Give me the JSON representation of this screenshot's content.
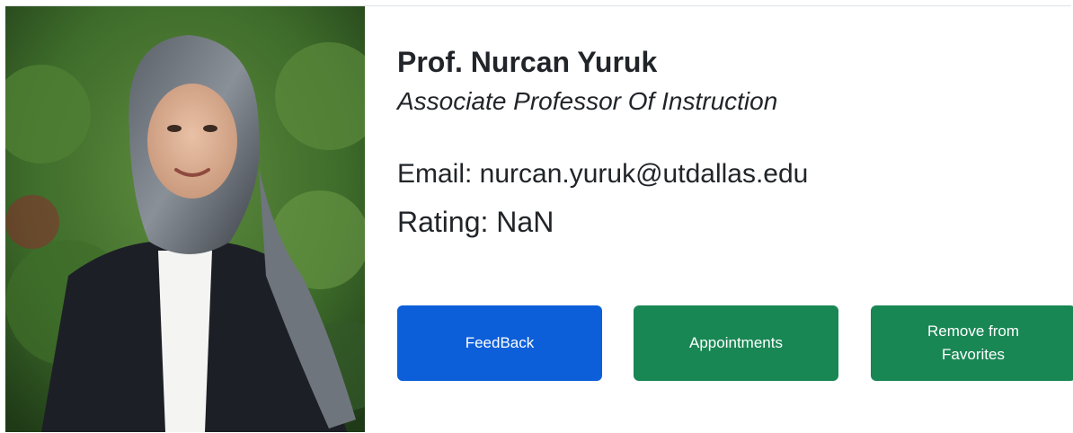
{
  "profile": {
    "name": "Prof. Nurcan Yuruk",
    "title": "Associate Professor Of Instruction",
    "email_label": "Email: nurcan.yuruk@utdallas.edu",
    "rating_label": "Rating: NaN",
    "photo_alt": "Prof. Nurcan Yuruk"
  },
  "actions": {
    "feedback_label": "FeedBack",
    "appointments_label": "Appointments",
    "remove_favorites_label": "Remove from Favorites"
  },
  "colors": {
    "feedback_button": "#0d5fd9",
    "primary_green": "#198754",
    "text": "#212529"
  }
}
